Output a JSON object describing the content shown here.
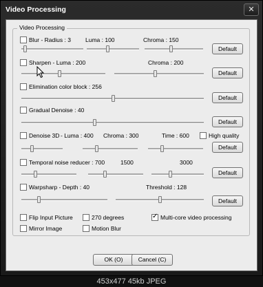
{
  "window": {
    "title": "Video Processing",
    "close_glyph": "✕"
  },
  "group": {
    "title": "Video Processing"
  },
  "rows": {
    "blur": {
      "label": "Blur - Radius : 3",
      "luma": "Luma : 100",
      "chroma": "Chroma : 150",
      "default": "Default",
      "checked": false,
      "radius_level": 0.05,
      "luma_level": 0.4,
      "chroma_level": 0.45
    },
    "sharpen": {
      "label": "Sharpen - Luma : 200",
      "chroma": "Chroma : 200",
      "default": "Default",
      "checked": false,
      "luma_level": 0.45,
      "chroma_level": 0.45
    },
    "elimination": {
      "label": "Elimination color block : 256",
      "default": "Default",
      "checked": false,
      "level": 0.5
    },
    "gradual": {
      "label": "Gradual Denoise : 40",
      "default": "Default",
      "checked": false,
      "level": 0.4
    },
    "denoise3d": {
      "label": "Denoise 3D",
      "luma": "- Luma : 400",
      "chroma": "Chroma : 300",
      "time": "Time : 600",
      "hq": "High quality",
      "default": "Default",
      "checked": false,
      "hq_checked": false,
      "luma_level": 0.25,
      "chroma_level": 0.25,
      "time_level": 0.25
    },
    "temporal": {
      "label": "Temporal noise reducer : 700",
      "mid": "1500",
      "right": "3000",
      "default": "Default",
      "checked": false,
      "level_a": 0.25,
      "level_b": 0.3,
      "level_c": 0.35
    },
    "warpsharp": {
      "label": "Warpsharp - Depth : 40",
      "threshold": "Threshold : 128",
      "default": "Default",
      "checked": false,
      "depth_level": 0.2,
      "threshold_level": 0.5
    }
  },
  "options": {
    "flip": {
      "label": "Flip Input Picture",
      "checked": false
    },
    "degrees": {
      "label": "270 degrees",
      "checked": false
    },
    "multicore": {
      "label": "Multi-core video processing",
      "checked": true
    },
    "mirror": {
      "label": "Mirror Image",
      "checked": false
    },
    "motion": {
      "label": "Motion Blur",
      "checked": false
    }
  },
  "buttons": {
    "ok": "OK (O)",
    "cancel": "Cancel (C)"
  },
  "caption": "453x477  45kb  JPEG"
}
